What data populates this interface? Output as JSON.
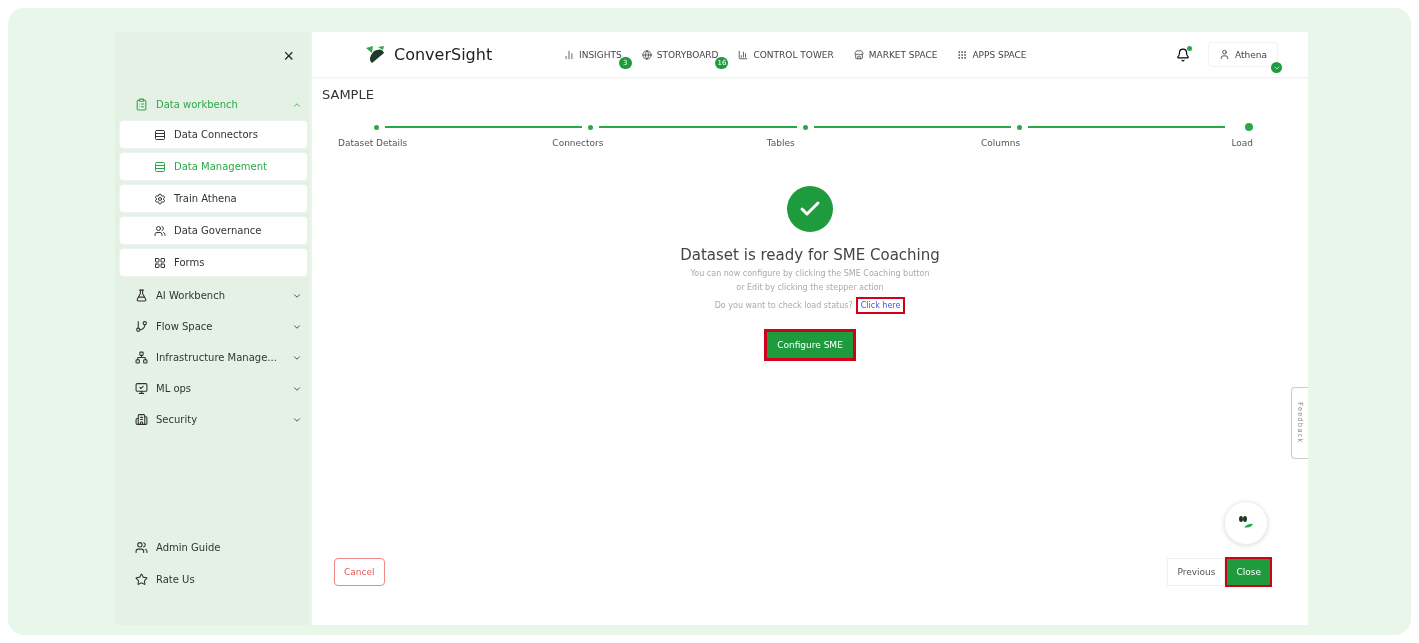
{
  "sidebar": {
    "close_label": "×",
    "groups": [
      {
        "label": "Data workbench",
        "expanded": true,
        "children": [
          {
            "label": "Data Connectors",
            "selected": false
          },
          {
            "label": "Data Management",
            "selected": true
          },
          {
            "label": "Train Athena",
            "selected": false
          },
          {
            "label": "Data Governance",
            "selected": false
          },
          {
            "label": "Forms",
            "selected": false
          }
        ]
      },
      {
        "label": "AI Workbench",
        "expanded": false
      },
      {
        "label": "Flow Space",
        "expanded": false
      },
      {
        "label": "Infrastructure Manage...",
        "expanded": false
      },
      {
        "label": "ML ops",
        "expanded": false
      },
      {
        "label": "Security",
        "expanded": false
      }
    ],
    "footer": [
      {
        "label": "Admin Guide"
      },
      {
        "label": "Rate Us"
      }
    ]
  },
  "topbar": {
    "logo": "ConverSight",
    "nav": [
      {
        "label": "INSIGHTS",
        "badge": "3"
      },
      {
        "label": "STORYBOARD",
        "badge": "16"
      },
      {
        "label": "CONTROL TOWER"
      },
      {
        "label": "MARKET SPACE"
      },
      {
        "label": "APPS SPACE"
      }
    ],
    "notification_dot": true,
    "user": "Athena"
  },
  "page_title": "SAMPLE",
  "stepper": [
    {
      "label": "Dataset Details",
      "completed": true
    },
    {
      "label": "Connectors",
      "completed": true
    },
    {
      "label": "Tables",
      "completed": true
    },
    {
      "label": "Columns",
      "completed": true
    },
    {
      "label": "Load",
      "completed": true
    }
  ],
  "message": {
    "title": "Dataset is ready for SME Coaching",
    "lines": [
      "You can now configure by clicking the SME Coaching button",
      "or Edit by clicking the stepper action",
      "Do you want to check load status?"
    ],
    "link": {
      "label": "Click here",
      "highlighted": true
    },
    "button": {
      "label": "Configure SME",
      "highlighted": true
    }
  },
  "feedback": "Feedback",
  "footer_buttons": [
    {
      "label": "Cancel",
      "kind": "danger",
      "highlighted": false
    },
    {
      "label": "Previous",
      "kind": "plain",
      "highlighted": false
    },
    {
      "label": "Close",
      "kind": "primary",
      "highlighted": true
    }
  ]
}
